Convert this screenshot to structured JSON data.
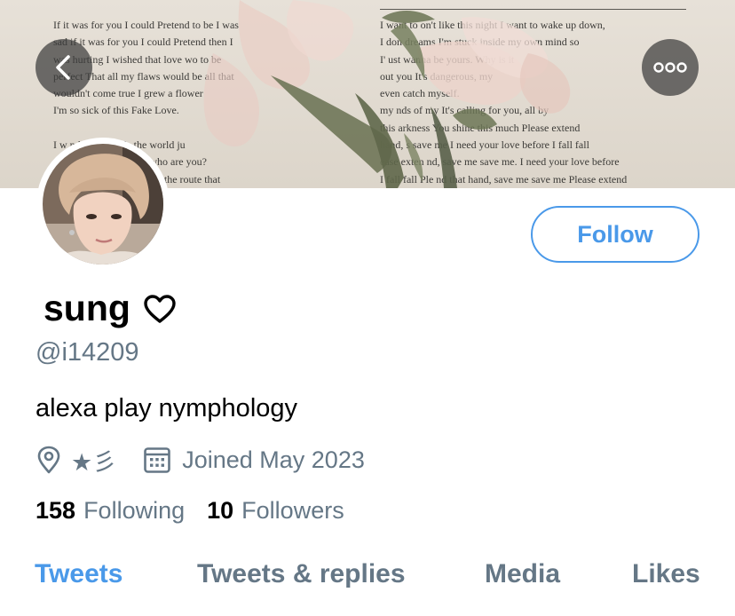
{
  "header": {
    "back_icon": "chevron-left-icon",
    "more_icon": "ellipsis-icon",
    "banner_lyrics_left": [
      "If it was for you I could Pretend to be  I  was",
      "sad if it was for you I could Pretend  then I",
      "was hurting I wished that love wo to be",
      "perfect That all my flaws would be all that",
      "wouldn't come true I grew a flower",
      "I'm so sick of this Fake Love.",
      "",
      "I w   nd man just fo    the world ju",
      "   ust for you No   no me, who are you?",
      "    you weren't there I forgot the route that"
    ],
    "banner_lyrics_right": [
      "I want to    on't like this night I want to wake up down,",
      "I don        dreams I'm stuck inside my own mind so",
      "I'        ust wanna be yours. Why is it",
      "          out you It's dangerous, my",
      "          even catch myself.",
      "my     nds of my    It's calling for you, all by",
      "this   arkness You shine this much Please extend",
      "hand, s  save me I need your love before I fall fall",
      "ease exten  nd, save me save me. I need your love before",
      "I fall fall Ple  nd that hand, save me save me Please extend"
    ]
  },
  "profile": {
    "avatar_alt": "avatar",
    "follow_label": "Follow",
    "display_name": "sung",
    "name_emoji_icon": "heart-outline-icon",
    "handle": "@i14209",
    "bio": "alexa play nymphology",
    "location_icon": "location-pin-icon",
    "location": "★彡",
    "calendar_icon": "calendar-icon",
    "joined": "Joined May 2023",
    "following_count": "158",
    "following_label": "Following",
    "followers_count": "10",
    "followers_label": "Followers"
  },
  "tabs": [
    {
      "label": "Tweets",
      "active": true
    },
    {
      "label": "Tweets & replies",
      "active": false
    },
    {
      "label": "Media",
      "active": false
    },
    {
      "label": "Likes",
      "active": false
    }
  ],
  "colors": {
    "accent": "#4a99e9",
    "secondary_text": "#657786",
    "primary_text": "#000000"
  }
}
